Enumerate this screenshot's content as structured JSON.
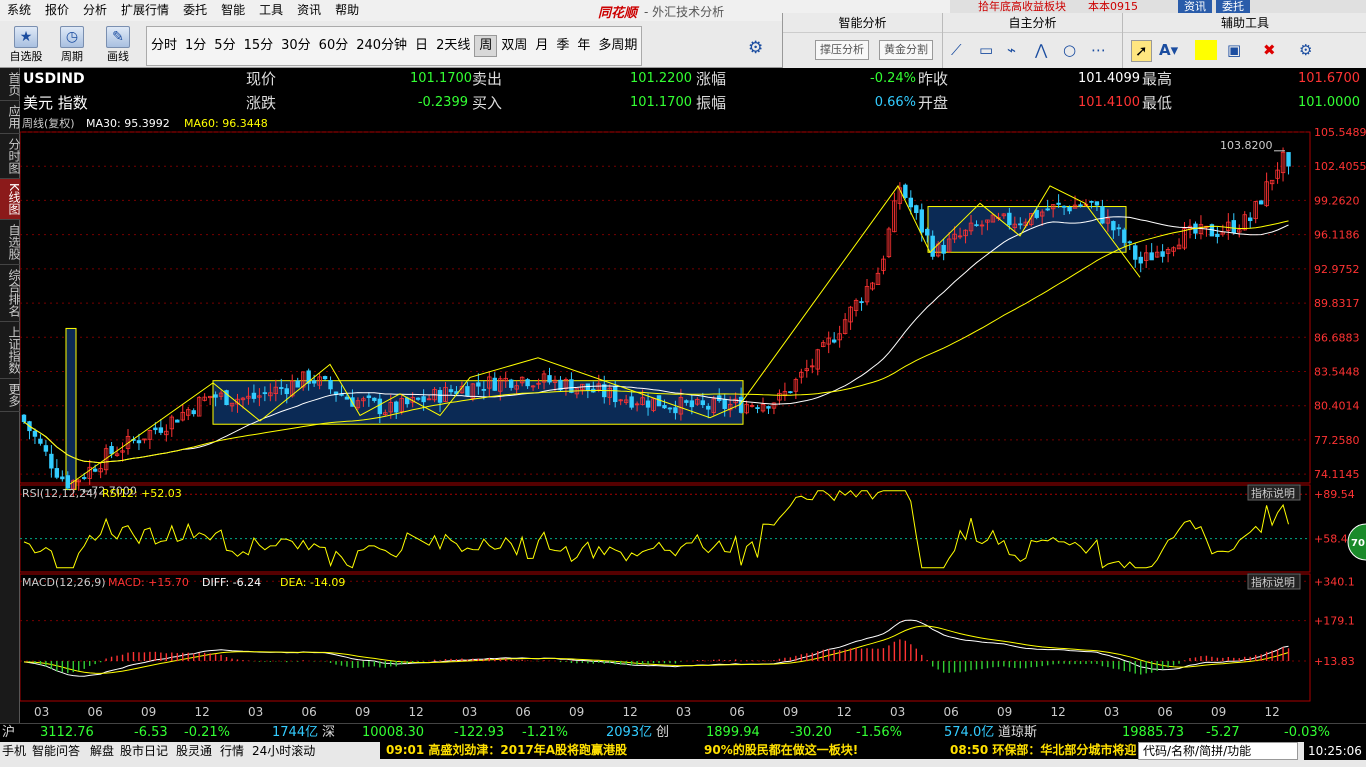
{
  "menu": [
    "系统",
    "报价",
    "分析",
    "扩展行情",
    "委托",
    "智能",
    "工具",
    "资讯",
    "帮助"
  ],
  "brand": "同花顺",
  "window_subtitle": "- 外汇技术分析",
  "toolbar": {
    "watchlist": "自选股",
    "period": "周期",
    "draw": "画线"
  },
  "periods": [
    "分时",
    "1分",
    "5分",
    "15分",
    "30分",
    "60分",
    "240分钟",
    "日",
    "2天线",
    "周",
    "双周",
    "月",
    "季",
    "年",
    "多周期"
  ],
  "selected_period": "周",
  "right_panel": {
    "smart": "智能分析",
    "own": "自主分析",
    "aux": "辅助工具",
    "support_btn": "撑压分析",
    "golden_btn": "黄金分割",
    "top_tabs": [
      "资讯",
      "委托"
    ],
    "top_scroll": "拾年底高收益板块",
    "top_user": "本本0915"
  },
  "sidebar": [
    "首页",
    "应用",
    "分时图",
    "K线图",
    "自选股",
    "综合排名",
    "上证指数",
    "更多"
  ],
  "sidebar_selected": "K线图",
  "quote": {
    "code": "USDIND",
    "name": "美元 指数",
    "now_label": "现价",
    "now": "101.1700",
    "sell_label": "卖出",
    "sell": "101.2200",
    "rise_label": "涨幅",
    "rise": "-0.24%",
    "prev_label": "昨收",
    "prev": "101.4099",
    "high_label": "最高",
    "high": "101.6700",
    "chg_label": "涨跌",
    "chg": "-0.2399",
    "buy_label": "买入",
    "buy": "101.1700",
    "amp_label": "振幅",
    "amp": "0.66%",
    "open_label": "开盘",
    "open": "101.4100",
    "low_label": "最低",
    "low": "101.0000"
  },
  "ma_legend": {
    "period": "周线(复权)",
    "ma30": "MA30: 95.3992",
    "ma60": "MA60: 96.3448"
  },
  "rsi_legend": {
    "name": "RSI(12,12,24)",
    "val": "RSI12: +52.03"
  },
  "macd_legend": {
    "name": "MACD(12,26,9)",
    "macd": "MACD: +15.70",
    "diff": "DIFF: -6.24",
    "dea": "DEA: -14.09"
  },
  "indicator_help": "指标说明",
  "badge": "70",
  "chart_data": {
    "type": "candlestick",
    "price_axis": {
      "ticks": [
        "105.5489",
        "102.4055",
        "99.2620",
        "96.1186",
        "92.9752",
        "89.8317",
        "86.6883",
        "83.5448",
        "80.4014",
        "77.2580",
        "74.1145"
      ],
      "range": [
        73.3,
        105.5489
      ]
    },
    "rsi_axis": {
      "ticks": [
        "+89.54",
        "+58.40"
      ],
      "range": [
        35,
        96
      ]
    },
    "macd_axis": {
      "ticks": [
        "+340.1",
        "+179.1",
        "+13.83"
      ],
      "range": [
        -150,
        370
      ]
    },
    "x_ticks": [
      "03",
      "06",
      "09",
      "12",
      "03",
      "06",
      "09",
      "12",
      "03",
      "06",
      "09",
      "12",
      "03",
      "06",
      "09",
      "12",
      "03",
      "06",
      "09",
      "12",
      "03",
      "06",
      "09",
      "12"
    ],
    "annotations": {
      "high": "103.8200",
      "low": "72.7000"
    }
  },
  "ticker": [
    {
      "t": "沪",
      "c": "#ddd"
    },
    {
      "t": "3112.76",
      "c": "#3f3"
    },
    {
      "t": "-6.53",
      "c": "#3f3"
    },
    {
      "t": "-0.21%",
      "c": "#3f3"
    },
    {
      "t": "1744亿",
      "c": "#3cf"
    },
    {
      "t": "深",
      "c": "#ddd"
    },
    {
      "t": "10008.30",
      "c": "#3f3"
    },
    {
      "t": "-122.93",
      "c": "#3f3"
    },
    {
      "t": "-1.21%",
      "c": "#3f3"
    },
    {
      "t": "2093亿",
      "c": "#3cf"
    },
    {
      "t": "创",
      "c": "#ddd"
    },
    {
      "t": "1899.94",
      "c": "#3f3"
    },
    {
      "t": "-30.20",
      "c": "#3f3"
    },
    {
      "t": "-1.56%",
      "c": "#3f3"
    },
    {
      "t": "574.0亿",
      "c": "#3cf"
    },
    {
      "t": "道琼斯",
      "c": "#ddd"
    },
    {
      "t": "19885.73",
      "c": "#3f3"
    },
    {
      "t": "-5.27",
      "c": "#3f3"
    },
    {
      "t": "-0.03%",
      "c": "#3f3"
    }
  ],
  "status": {
    "items": [
      "手机",
      "智能问答",
      "解盘",
      "股市日记",
      "股灵通",
      "行情",
      "24小时滚动"
    ],
    "news": [
      "09:01 高盛刘劲津：2017年A股将跑赢港股",
      "90%的股民都在做这一板块!",
      "08:50 环保部：华北部分城市将迎"
    ],
    "search": "代码/名称/简拼/功能",
    "time": "10:25:06"
  }
}
